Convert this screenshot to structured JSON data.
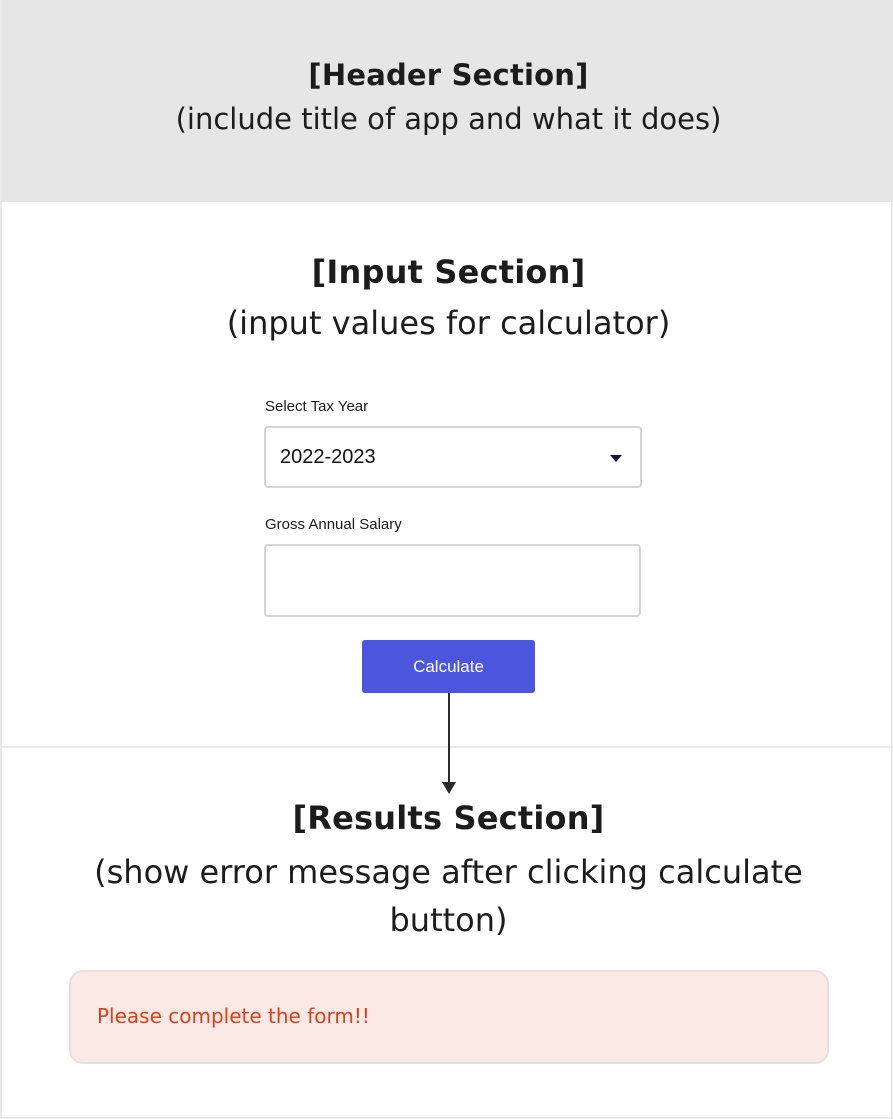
{
  "header": {
    "title": "[Header Section]",
    "subtitle": "(include title of app and what it does)"
  },
  "input_section": {
    "title": "[Input Section]",
    "subtitle": "(input values for calculator)",
    "tax_year": {
      "label": "Select Tax Year",
      "value": "2022-2023",
      "icon": "caret-down-icon"
    },
    "salary": {
      "label": "Gross Annual Salary",
      "value": "",
      "placeholder": ""
    },
    "calculate_label": "Calculate"
  },
  "results_section": {
    "title": "[Results Section]",
    "subtitle": "(show error message after clicking calculate button)",
    "error_message": "Please complete the form!!"
  },
  "colors": {
    "header_bg": "#e6e6e6",
    "button_bg": "#4c55de",
    "error_bg": "#fbe9e6",
    "error_text": "#d9411a"
  }
}
